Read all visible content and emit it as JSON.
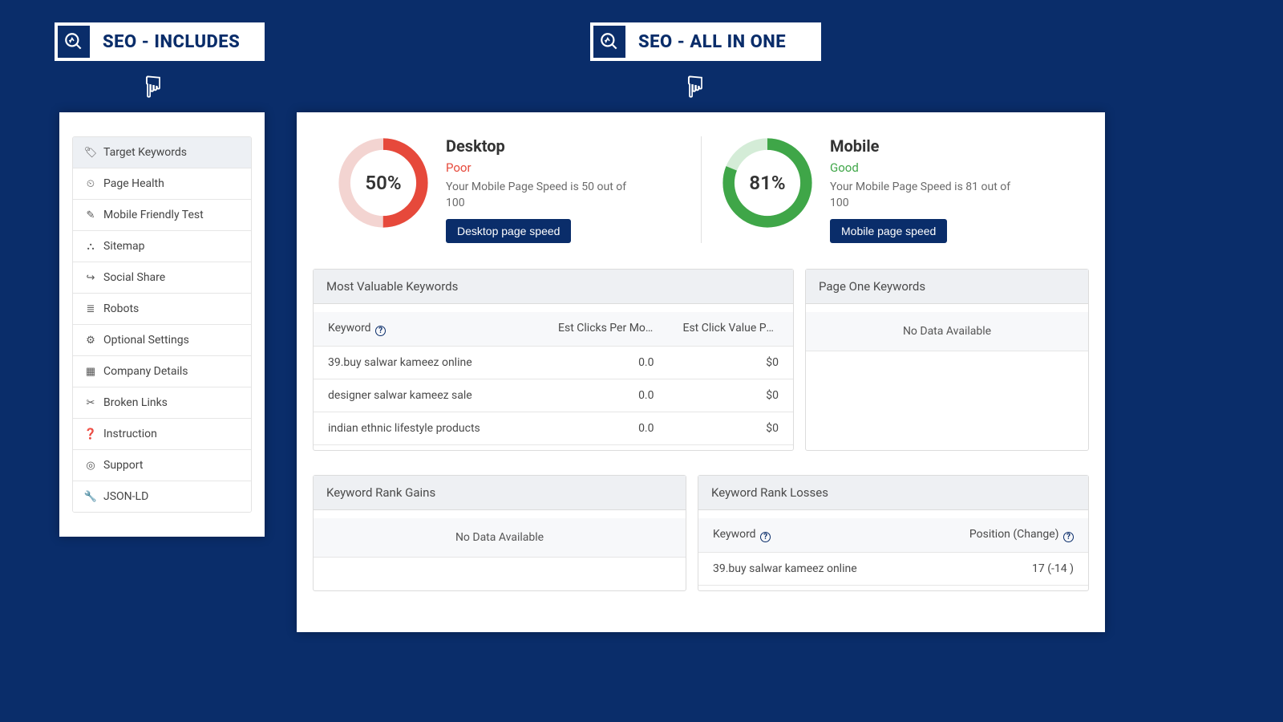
{
  "banners": {
    "left": "SEO - INCLUDES",
    "right": "SEO - ALL IN ONE"
  },
  "sidebar": {
    "items": [
      {
        "icon": "tag-icon",
        "glyph": "🏷",
        "label": "Target Keywords",
        "active": true
      },
      {
        "icon": "speed-icon",
        "glyph": "⏲",
        "label": "Page Health"
      },
      {
        "icon": "edit-icon",
        "glyph": "✎",
        "label": "Mobile Friendly Test"
      },
      {
        "icon": "sitemap-icon",
        "glyph": "⛬",
        "label": "Sitemap"
      },
      {
        "icon": "share-icon",
        "glyph": "↪",
        "label": "Social Share"
      },
      {
        "icon": "list-icon",
        "glyph": "≣",
        "label": "Robots"
      },
      {
        "icon": "gear-icon",
        "glyph": "⚙",
        "label": "Optional Settings"
      },
      {
        "icon": "calendar-icon",
        "glyph": "▦",
        "label": "Company Details"
      },
      {
        "icon": "unlink-icon",
        "glyph": "✂",
        "label": "Broken Links"
      },
      {
        "icon": "help-icon",
        "glyph": "❓",
        "label": "Instruction"
      },
      {
        "icon": "life-ring-icon",
        "glyph": "◎",
        "label": "Support"
      },
      {
        "icon": "wrench-icon",
        "glyph": "🔧",
        "label": "JSON-LD"
      }
    ]
  },
  "speed": {
    "desktop": {
      "title": "Desktop",
      "pct": "50%",
      "value": 50,
      "status": "Poor",
      "status_class": "status-poor",
      "desc": "Your Mobile Page Speed is 50 out of 100",
      "btn": "Desktop page speed",
      "color": "#e6493b"
    },
    "mobile": {
      "title": "Mobile",
      "pct": "81%",
      "value": 81,
      "status": "Good",
      "status_class": "status-good",
      "desc": "Your Mobile Page Speed is 81 out of 100",
      "btn": "Mobile page speed",
      "color": "#3fa648"
    }
  },
  "mvk": {
    "title": "Most Valuable Keywords",
    "cols": {
      "kw": "Keyword",
      "clicks": "Est Clicks Per Mo",
      "value": "Est Click Value Per Mo"
    },
    "rows": [
      {
        "kw": "39.buy salwar kameez online",
        "clicks": "0.0",
        "value": "$0"
      },
      {
        "kw": "designer salwar kameez sale",
        "clicks": "0.0",
        "value": "$0"
      },
      {
        "kw": "indian ethnic lifestyle products",
        "clicks": "0.0",
        "value": "$0"
      }
    ]
  },
  "pok": {
    "title": "Page One Keywords",
    "no_data": "No Data Available"
  },
  "gains": {
    "title": "Keyword Rank Gains",
    "no_data": "No Data Available"
  },
  "losses": {
    "title": "Keyword Rank Losses",
    "cols": {
      "kw": "Keyword",
      "pos": "Position (Change)"
    },
    "rows": [
      {
        "kw": "39.buy salwar kameez online",
        "pos": "17 (-14    )"
      }
    ]
  }
}
